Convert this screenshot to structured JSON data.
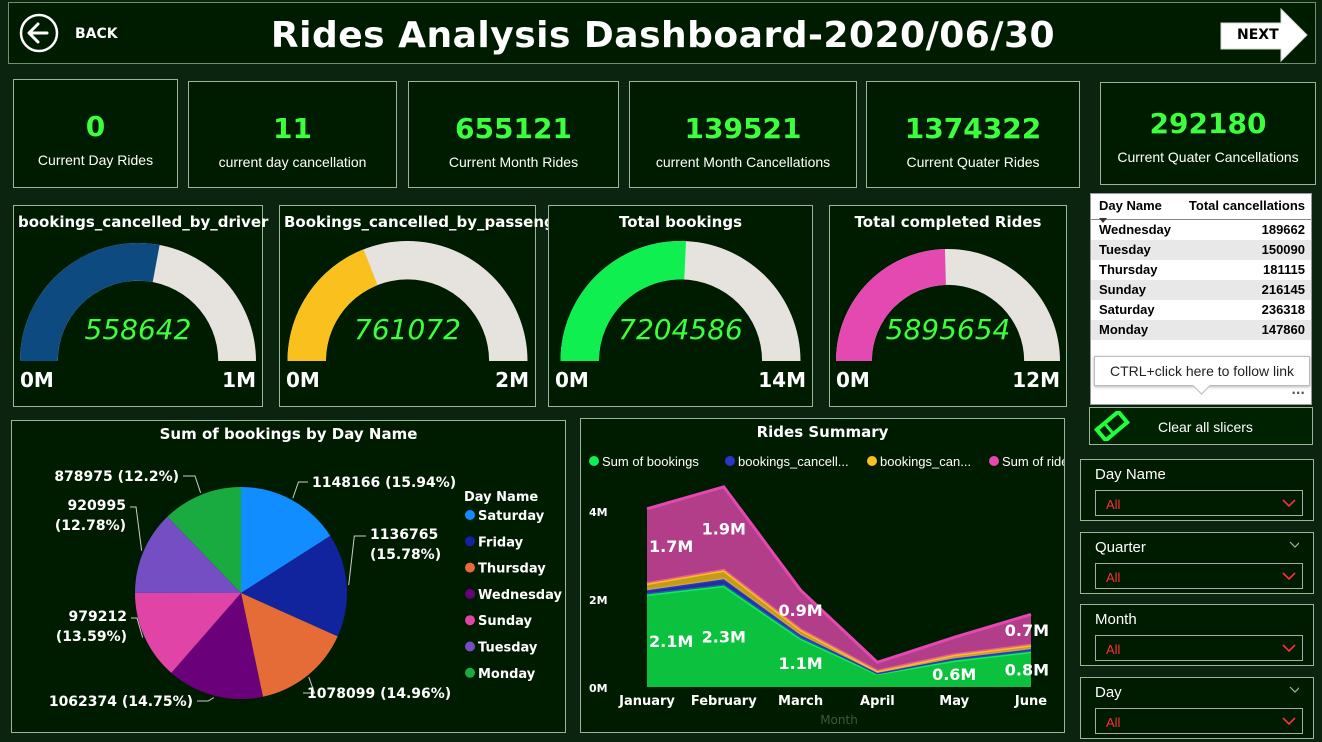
{
  "header": {
    "back_label": "BACK",
    "title": "Rides Analysis Dashboard-2020/06/30",
    "next_label": "NEXT"
  },
  "kpis": [
    {
      "value": "0",
      "label": "Current Day Rides"
    },
    {
      "value": "11",
      "label": "current day cancellation"
    },
    {
      "value": "655121",
      "label": "Current Month Rides"
    },
    {
      "value": "139521",
      "label": "current Month Cancellations"
    },
    {
      "value": "1374322",
      "label": "Current Quater Rides"
    },
    {
      "value": "292180",
      "label": "Current Quater Cancellations"
    }
  ],
  "gauges": [
    {
      "title": "bookings_cancelled_by_driver",
      "value_label": "558642",
      "min_label": "0M",
      "max_label": "1M",
      "fraction": 0.5586,
      "color": "#0d4a80"
    },
    {
      "title": "Bookings_cancelled_by_passenger",
      "value_label": "761072",
      "min_label": "0M",
      "max_label": "2M",
      "fraction": 0.3805,
      "color": "#f9c01e"
    },
    {
      "title": "Total bookings",
      "value_label": "7204586",
      "min_label": "0M",
      "max_label": "14M",
      "fraction": 0.5146,
      "color": "#0ff050"
    },
    {
      "title": "Total completed Rides",
      "value_label": "5895654",
      "min_label": "0M",
      "max_label": "12M",
      "fraction": 0.4913,
      "color": "#e448b1"
    }
  ],
  "day_table": {
    "headers": [
      "Day Name",
      "Total cancellations"
    ],
    "rows": [
      [
        "Wednesday",
        "189662"
      ],
      [
        "Tuesday",
        "150090"
      ],
      [
        "Thursday",
        "181115"
      ],
      [
        "Sunday",
        "216145"
      ],
      [
        "Saturday",
        "236318"
      ],
      [
        "Monday",
        "147860"
      ]
    ]
  },
  "tooltip": "CTRL+click here to follow link",
  "clear_slicers_label": "Clear all slicers",
  "slicers": [
    {
      "title": "Day Name",
      "value": "All"
    },
    {
      "title": "Quarter",
      "value": "All"
    },
    {
      "title": "Month",
      "value": "All"
    },
    {
      "title": "Day",
      "value": "All"
    }
  ],
  "chart_data": [
    {
      "type": "pie",
      "title": "Sum of bookings by Day Name",
      "legend_title": "Day Name",
      "legend_position": "right",
      "slices": [
        {
          "name": "Saturday",
          "value": 1148166,
          "label": "1148166 (15.94%)",
          "color": "#118dff"
        },
        {
          "name": "Friday",
          "value": 1136765,
          "label": "1136765 (15.78%)",
          "color": "#12239e"
        },
        {
          "name": "Thursday",
          "value": 1078099,
          "label": "1078099 (14.96%)",
          "color": "#e66c37"
        },
        {
          "name": "Wednesday",
          "value": 1062374,
          "label": "1062374 (14.75%)",
          "color": "#6b007b"
        },
        {
          "name": "Sunday",
          "value": 979212,
          "label": "979212 (13.59%)",
          "color": "#e044a7"
        },
        {
          "name": "Tuesday",
          "value": 920995,
          "label": "920995 (12.78%)",
          "color": "#744ec2"
        },
        {
          "name": "Monday",
          "value": 878975,
          "label": "878975 (12.2%)",
          "color": "#1aab40"
        }
      ]
    },
    {
      "type": "area",
      "title": "Rides Summary",
      "xlabel": "Month",
      "categories": [
        "January",
        "February",
        "March",
        "April",
        "May",
        "June"
      ],
      "ylim": [
        0,
        4500000
      ],
      "y_ticks": [
        "0M",
        "2M",
        "4M"
      ],
      "series": [
        {
          "name": "Sum of bookings",
          "color": "#0ff050",
          "values": [
            2100000,
            2300000,
            1100000,
            300000,
            600000,
            800000
          ]
        },
        {
          "name": "bookings_cancell...",
          "color": "#2a36c8",
          "values": [
            100000,
            150000,
            80000,
            20000,
            50000,
            60000
          ]
        },
        {
          "name": "bookings_can...",
          "color": "#f9c01e",
          "values": [
            150000,
            200000,
            120000,
            40000,
            80000,
            90000
          ]
        },
        {
          "name": "Sum of rides",
          "color": "#e448b1",
          "values": [
            1700000,
            1900000,
            900000,
            200000,
            400000,
            700000
          ]
        }
      ],
      "data_labels": [
        {
          "series": "Sum of bookings",
          "values": [
            "2.1M",
            "2.3M",
            "1.1M",
            "",
            "0.6M",
            "0.8M"
          ]
        },
        {
          "series": "Sum of rides",
          "values": [
            "1.7M",
            "1.9M",
            "0.9M",
            "",
            "",
            "0.7M"
          ]
        }
      ]
    }
  ]
}
